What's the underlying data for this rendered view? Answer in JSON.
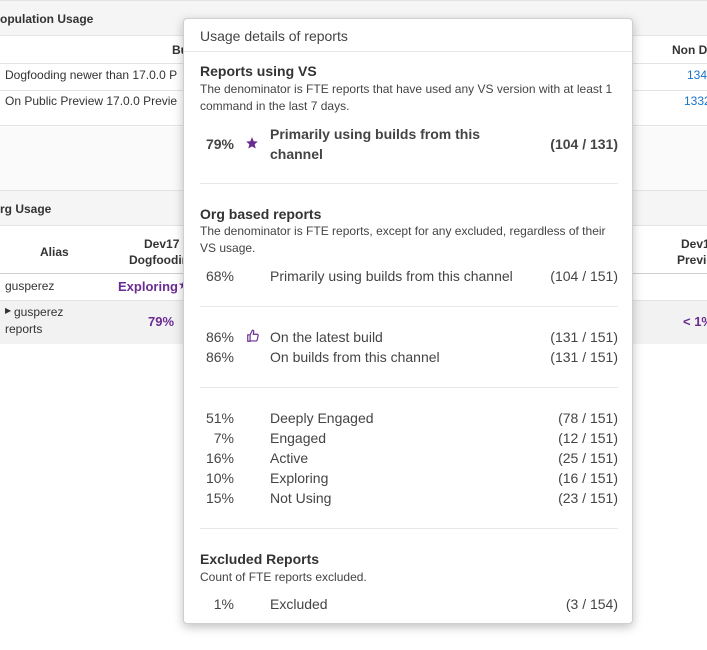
{
  "background": {
    "population": {
      "title": "opulation Usage",
      "col_bu": "Bu",
      "col_nond": "Non D",
      "rows": [
        {
          "label": "Dogfooding newer than 17.0.0 P",
          "value": "134"
        },
        {
          "label": "On Public Preview 17.0.0 Previe",
          "value": "1332"
        }
      ]
    },
    "org": {
      "title": "rg Usage",
      "col_alias": "Alias",
      "col_dev17_line1": "Dev17",
      "col_dev17_line2": "Dogfoodin",
      "col_right_line1": "Dev1",
      "col_right_line2": "Previe",
      "rows": [
        {
          "alias": "gusperez",
          "value": "Exploring"
        },
        {
          "alias_line1": "gusperez",
          "alias_line2": "reports",
          "value": "79%",
          "right_value": "< 1%"
        }
      ]
    }
  },
  "popup": {
    "title": "Usage details of reports",
    "vs": {
      "heading": "Reports using VS",
      "desc": "The denominator is FTE reports that have used any VS version with at least 1 command in the last 7 days.",
      "row": {
        "pct": "79%",
        "icon": "star-icon",
        "label_line1": "Primarily using builds from this",
        "label_line2": "channel",
        "count": "(104 / 131)"
      }
    },
    "org": {
      "heading": "Org based reports",
      "desc": "The denominator is FTE reports, except for any excluded, regardless of their VS usage.",
      "primary": {
        "pct": "68%",
        "label": "Primarily using builds from this channel",
        "count": "(104 / 151)"
      },
      "builds": [
        {
          "pct": "86%",
          "icon": "thumbs-up-icon",
          "label": "On the latest build",
          "count": "(131 / 151)"
        },
        {
          "pct": "86%",
          "label": "On builds from this channel",
          "count": "(131 / 151)"
        }
      ],
      "engagement": [
        {
          "pct": "51%",
          "label": "Deeply Engaged",
          "count": "(78 / 151)"
        },
        {
          "pct": "7%",
          "label": "Engaged",
          "count": "(12 / 151)"
        },
        {
          "pct": "16%",
          "label": "Active",
          "count": "(25 / 151)"
        },
        {
          "pct": "10%",
          "label": "Exploring",
          "count": "(16 / 151)"
        },
        {
          "pct": "15%",
          "label": "Not Using",
          "count": "(23 / 151)"
        }
      ]
    },
    "excluded": {
      "heading": "Excluded Reports",
      "desc": "Count of FTE reports excluded.",
      "row": {
        "pct": "1%",
        "label": "Excluded",
        "count": "(3 / 154)"
      }
    }
  },
  "colors": {
    "accent_purple": "#6b2c91",
    "link_blue": "#1a73c9"
  }
}
